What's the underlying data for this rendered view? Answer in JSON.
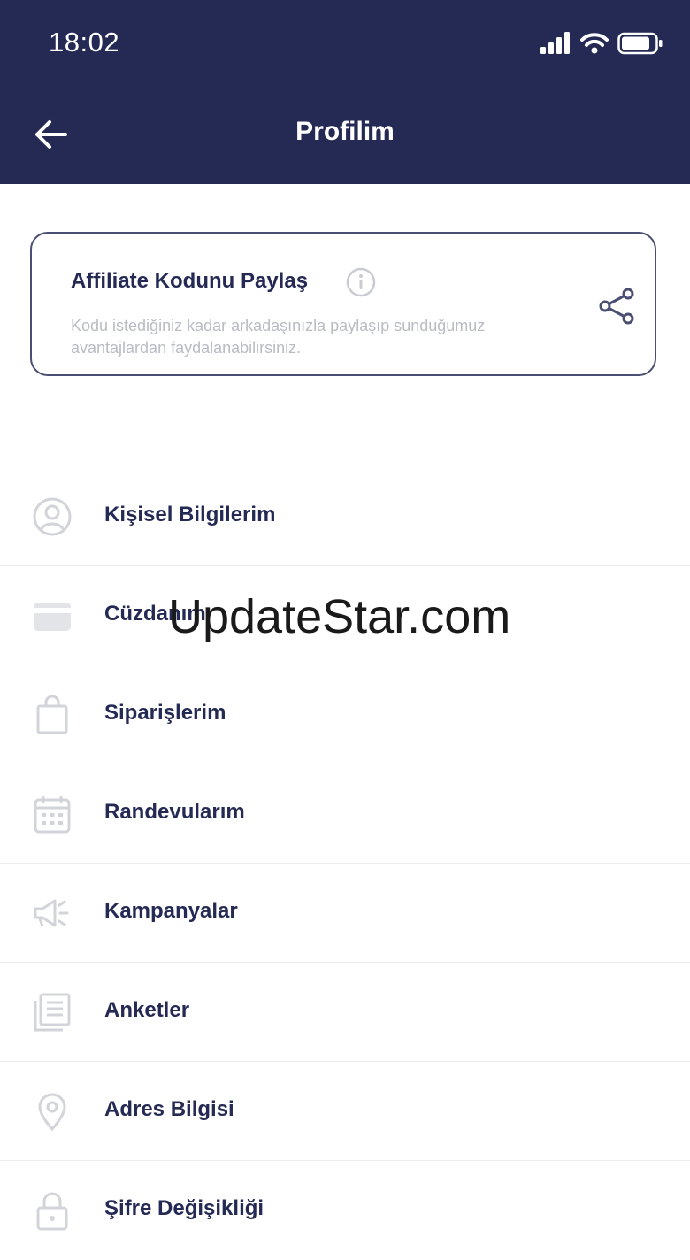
{
  "status_bar": {
    "time": "18:02",
    "icons": [
      "signal-icon",
      "wifi-icon",
      "battery-icon"
    ]
  },
  "header": {
    "title": "Profilim",
    "back_icon": "back-arrow-icon",
    "background": "#252a55"
  },
  "affiliate": {
    "title": "Affiliate Kodunu Paylaş",
    "description": "Kodu istediğiniz kadar arkadaşınızla paylaşıp sunduğumuz avantajlardan faydalanabilirsiniz.",
    "info_icon": "info-icon",
    "share_icon": "share-icon"
  },
  "menu": {
    "items": [
      {
        "label": "Kişisel Bilgilerim",
        "icon": "user-icon"
      },
      {
        "label": "Cüzdanım",
        "icon": "wallet-icon"
      },
      {
        "label": "Siparişlerim",
        "icon": "shopping-bag-icon"
      },
      {
        "label": "Randevularım",
        "icon": "calendar-icon"
      },
      {
        "label": "Kampanyalar",
        "icon": "megaphone-icon"
      },
      {
        "label": "Anketler",
        "icon": "survey-icon"
      },
      {
        "label": "Adres Bilgisi",
        "icon": "location-pin-icon"
      },
      {
        "label": "Şifre Değişikliği",
        "icon": "lock-icon"
      }
    ]
  },
  "watermark": {
    "text": "UpdateStar.com"
  },
  "colors": {
    "primary": "#252a55",
    "muted_text": "#b9bcc5",
    "icon_gray": "#d3d4d9"
  }
}
